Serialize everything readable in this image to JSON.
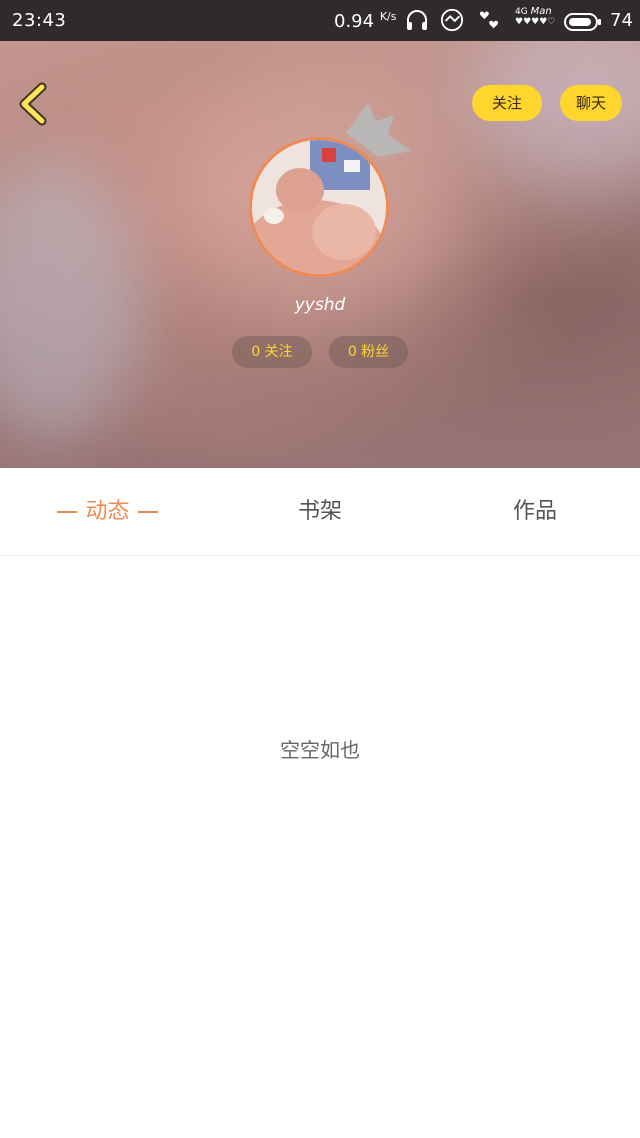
{
  "status_bar": {
    "time": "23:43",
    "speed": "0.94",
    "speed_unit": "K/s",
    "network_type": "4G",
    "carrier_label": "Man",
    "battery": "74"
  },
  "header": {
    "follow_button": "关注",
    "chat_button": "聊天",
    "username": "yyshd",
    "following_stat": "0 关注",
    "fans_stat": "0 粉丝"
  },
  "tabs": [
    {
      "label": "动态",
      "active": true
    },
    {
      "label": "书架",
      "active": false
    },
    {
      "label": "作品",
      "active": false
    }
  ],
  "content": {
    "empty_text": "空空如也"
  },
  "colors": {
    "accent": "#f0894f",
    "button_yellow": "#ffd52e",
    "status_bar": "#2f2b2b"
  },
  "icons": [
    "back-arrow-icon",
    "crown-icon",
    "headphones-icon",
    "weather-icon",
    "signal-icon",
    "battery-icon"
  ]
}
